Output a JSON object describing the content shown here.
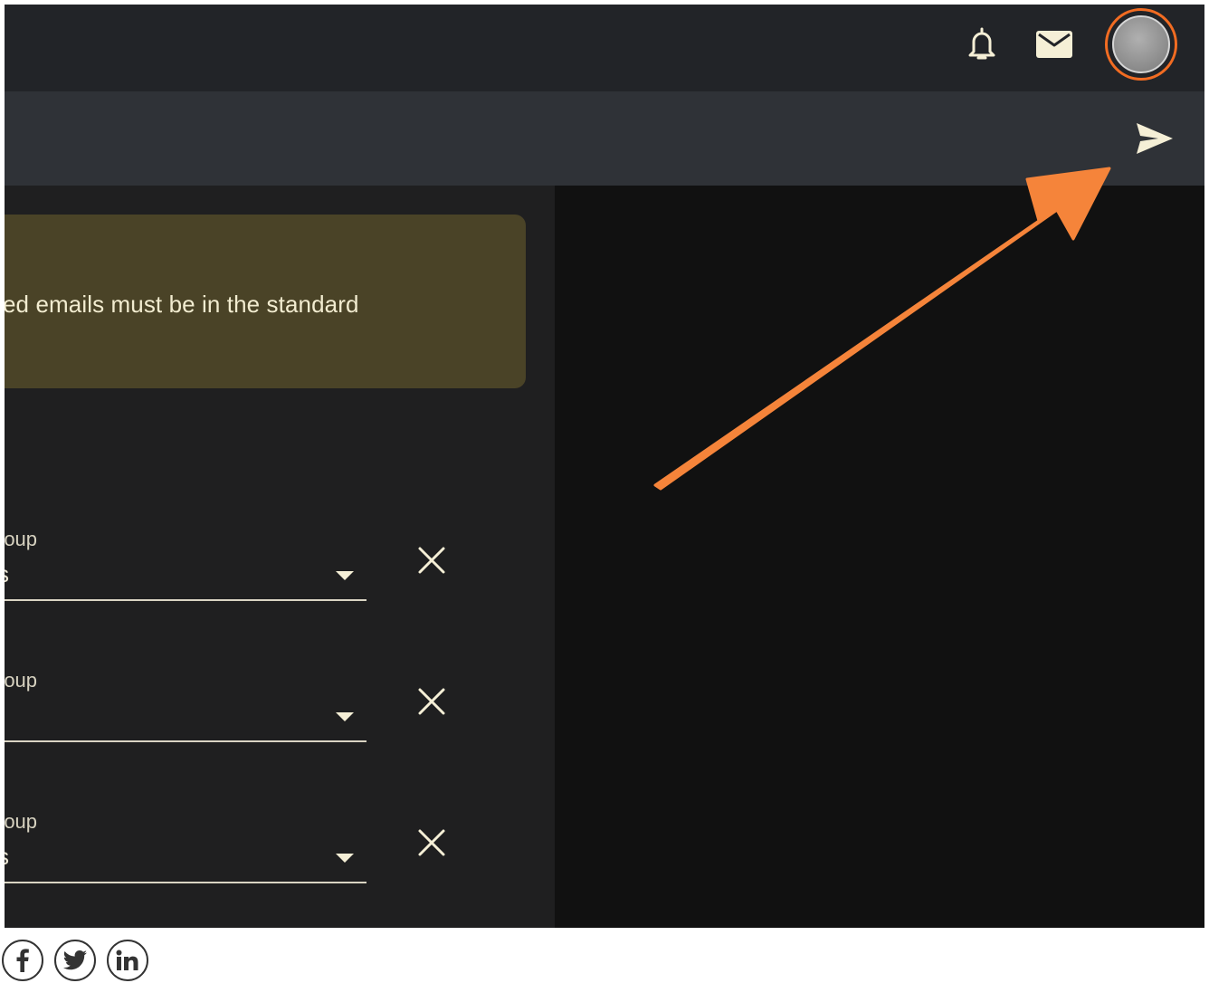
{
  "header": {
    "icons": [
      "bell-icon",
      "mail-icon"
    ],
    "avatar": "user-avatar"
  },
  "compose_bar": {
    "send_icon": "send-icon"
  },
  "notice": {
    "text": "ed emails must be in the standard"
  },
  "groups": [
    {
      "label": "roup",
      "value": "s"
    },
    {
      "label": "roup",
      "value": ")"
    },
    {
      "label": "roup",
      "value": "s"
    }
  ],
  "social": [
    "facebook-icon",
    "twitter-icon",
    "linkedin-icon"
  ],
  "colors": {
    "topbar": "#222428",
    "subbar": "#2f3237",
    "notice_bg": "#4a4327",
    "accent_arrow": "#f5843a",
    "avatar_ring": "#f26c22",
    "icon_fg": "#f5efd6"
  }
}
